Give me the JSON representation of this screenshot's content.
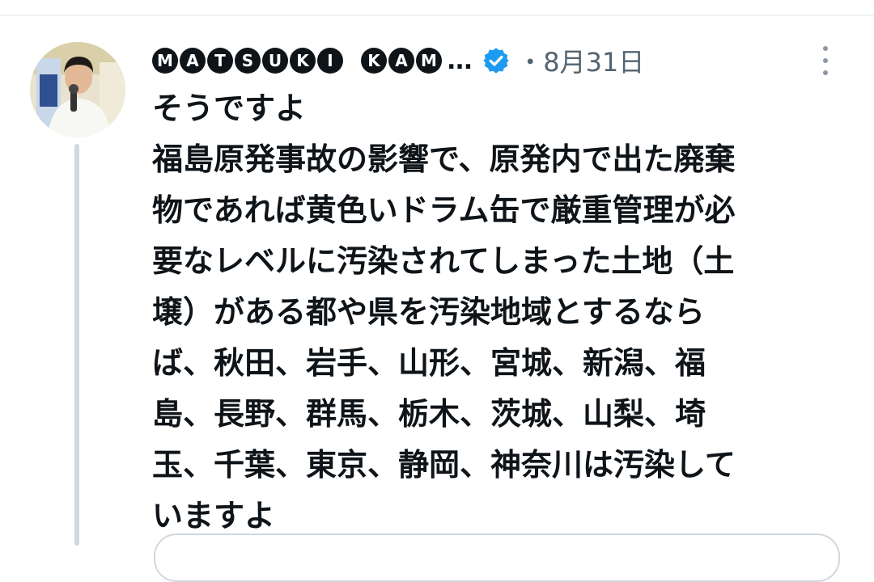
{
  "tweet": {
    "author": {
      "name_letters": [
        "M",
        "A",
        "T",
        "S",
        "U",
        "K",
        "I",
        " ",
        "K",
        "A",
        "M"
      ],
      "name_overflow": "...",
      "verified": true,
      "verified_color": "#1d9bf0"
    },
    "date": "・8月31日",
    "text_lines": [
      "そうですよ",
      "福島原発事故の影響で、原発内で出た廃棄",
      "物であれば黄色いドラム缶で厳重管理が必",
      "要なレベルに汚染されてしまった土地（土",
      "壌）がある都や県を汚染地域とするなら",
      "ば、秋田、岩手、山形、宮城、新潟、福",
      "島、長野、群馬、栃木、茨城、山梨、埼",
      "玉、千葉、東京、静岡、神奈川は汚染して",
      "いますよ"
    ]
  },
  "colors": {
    "text": "#0f1419",
    "secondary": "#536471",
    "thread_line": "#cfd9de"
  },
  "icons": {
    "verified": "verified-badge-icon",
    "more": "more-options-icon"
  }
}
